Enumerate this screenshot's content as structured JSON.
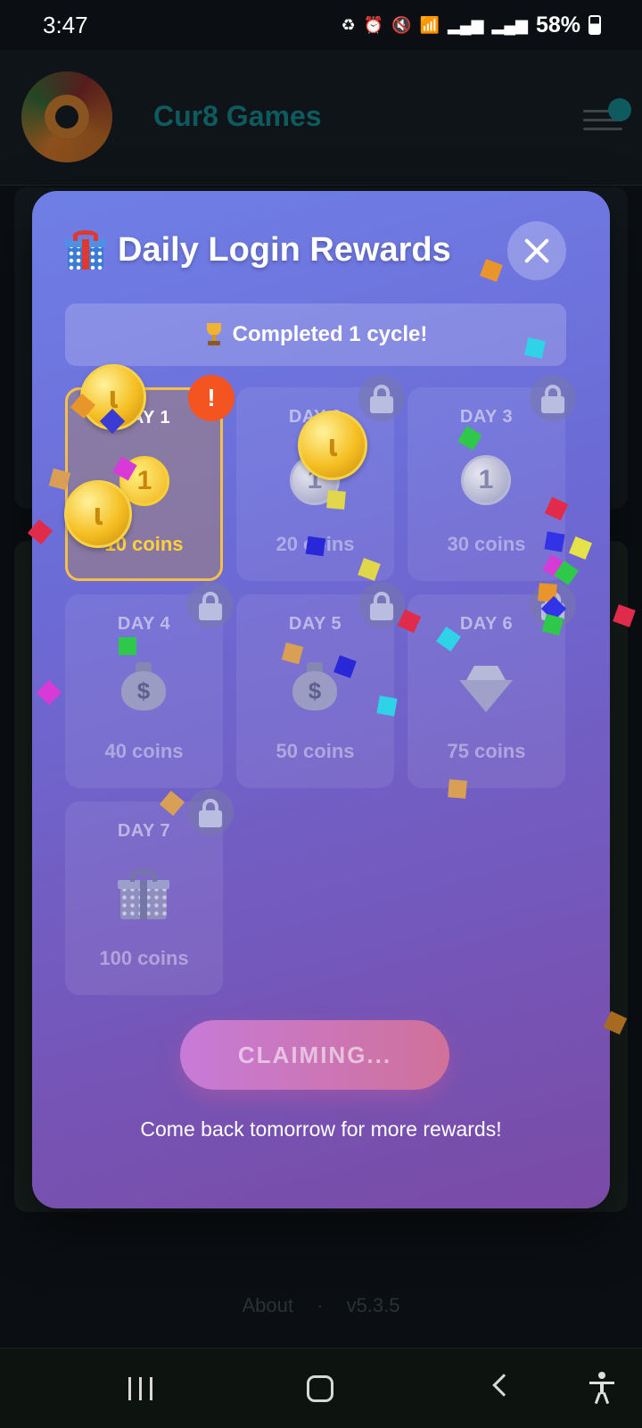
{
  "status_bar": {
    "time": "3:47",
    "battery_percent": "58%",
    "icons": [
      "recycle-icon",
      "alarm-icon",
      "mute-icon",
      "wifi-icon",
      "signal-icon",
      "signal-icon",
      "battery-icon"
    ]
  },
  "app": {
    "title": "Cur8 Games",
    "footer_about": "About",
    "footer_separator": "·",
    "footer_version": "v5.3.5"
  },
  "modal": {
    "title": "Daily Login Rewards",
    "title_icon": "gift-icon",
    "close_icon": "close-icon",
    "cycle_banner": "Completed 1 cycle!",
    "cycle_icon": "trophy-icon",
    "days": [
      {
        "label": "DAY 1",
        "reward": "10 coins",
        "icon": "coin-icon",
        "state": "available",
        "badge": "!"
      },
      {
        "label": "DAY 2",
        "reward": "20 coins",
        "icon": "coin-icon",
        "state": "locked"
      },
      {
        "label": "DAY 3",
        "reward": "30 coins",
        "icon": "coin-icon",
        "state": "locked"
      },
      {
        "label": "DAY 4",
        "reward": "40 coins",
        "icon": "money-bag-icon",
        "state": "locked"
      },
      {
        "label": "DAY 5",
        "reward": "50 coins",
        "icon": "money-bag-icon",
        "state": "locked"
      },
      {
        "label": "DAY 6",
        "reward": "75 coins",
        "icon": "diamond-icon",
        "state": "locked"
      },
      {
        "label": "DAY 7",
        "reward": "100 coins",
        "icon": "gift-box-icon",
        "state": "locked"
      }
    ],
    "claim_button": "CLAIMING...",
    "footer_note": "Come back tomorrow for more rewards!"
  },
  "colors": {
    "modal_top": "#6f7fe6",
    "modal_bottom": "#7a4aa6",
    "active_border": "#f4c04a",
    "reward_gold": "#ffd23a",
    "alert_badge": "#f4541f",
    "claim_button_start": "#c77bd8",
    "claim_button_end": "#d0719a",
    "brand_teal": "#0f5a5e"
  }
}
